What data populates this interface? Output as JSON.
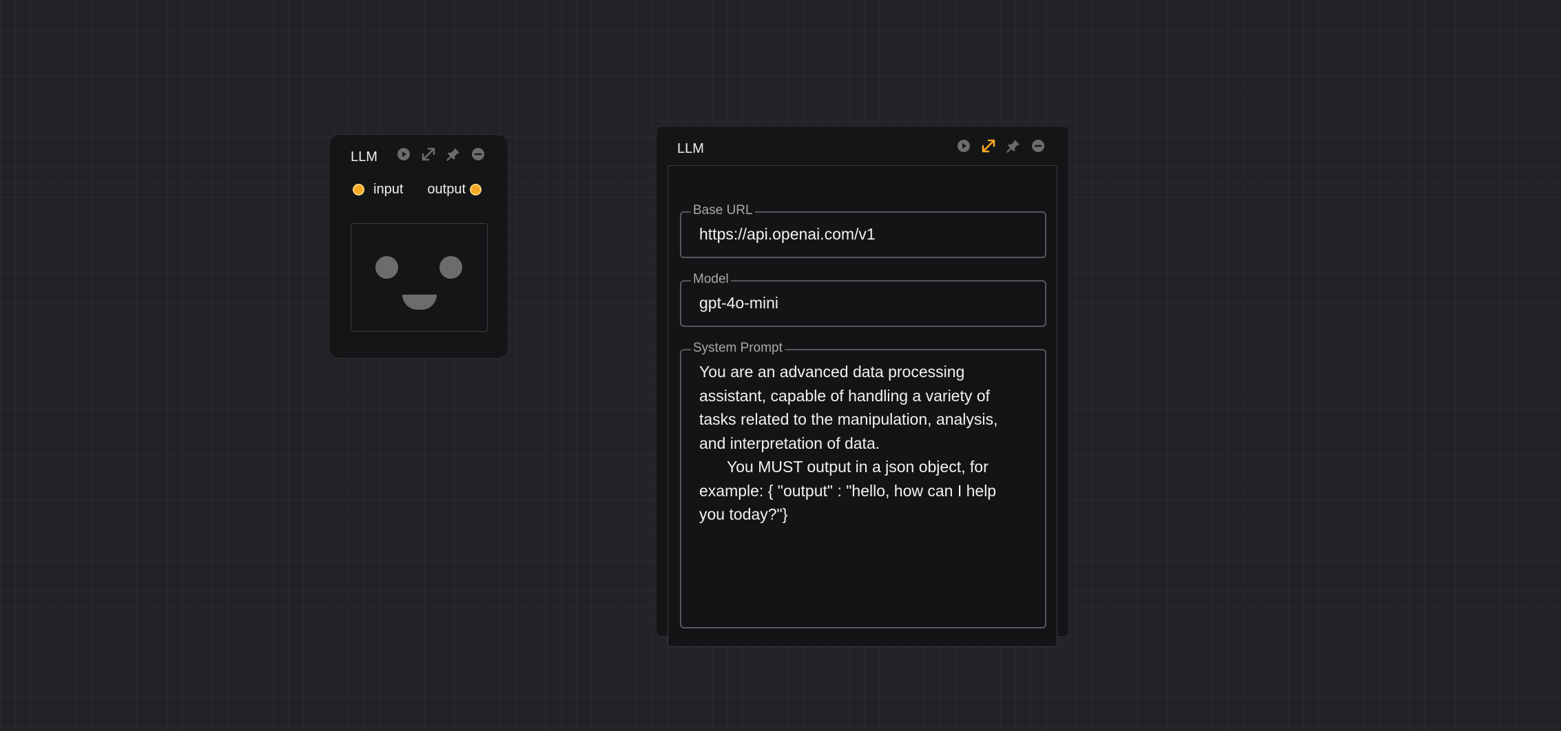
{
  "small_node": {
    "title": "LLM",
    "input_label": "input",
    "output_label": "output",
    "toolbar_icons": [
      "play-icon",
      "expand-icon",
      "pin-icon",
      "minus-icon"
    ]
  },
  "large_node": {
    "title": "LLM",
    "toolbar_icons": [
      "play-icon",
      "expand-icon",
      "pin-icon",
      "minus-icon"
    ],
    "base_url": {
      "label": "Base URL",
      "value": "https://api.openai.com/v1"
    },
    "model": {
      "label": "Model",
      "value": "gpt-4o-mini"
    },
    "system_prompt": {
      "label": "System Prompt",
      "line1": "You are an advanced data processing assistant, capable of handling a variety of tasks related to the manipulation, analysis, and interpretation of data.",
      "line2": "You MUST output in a json object, for example: { \"output\" : \"hello, how can I help you today?\"}"
    }
  },
  "colors": {
    "background": "#222326",
    "node_background": "#141517",
    "accent": "#f4a823",
    "icon_gray": "#6c6c6c"
  }
}
